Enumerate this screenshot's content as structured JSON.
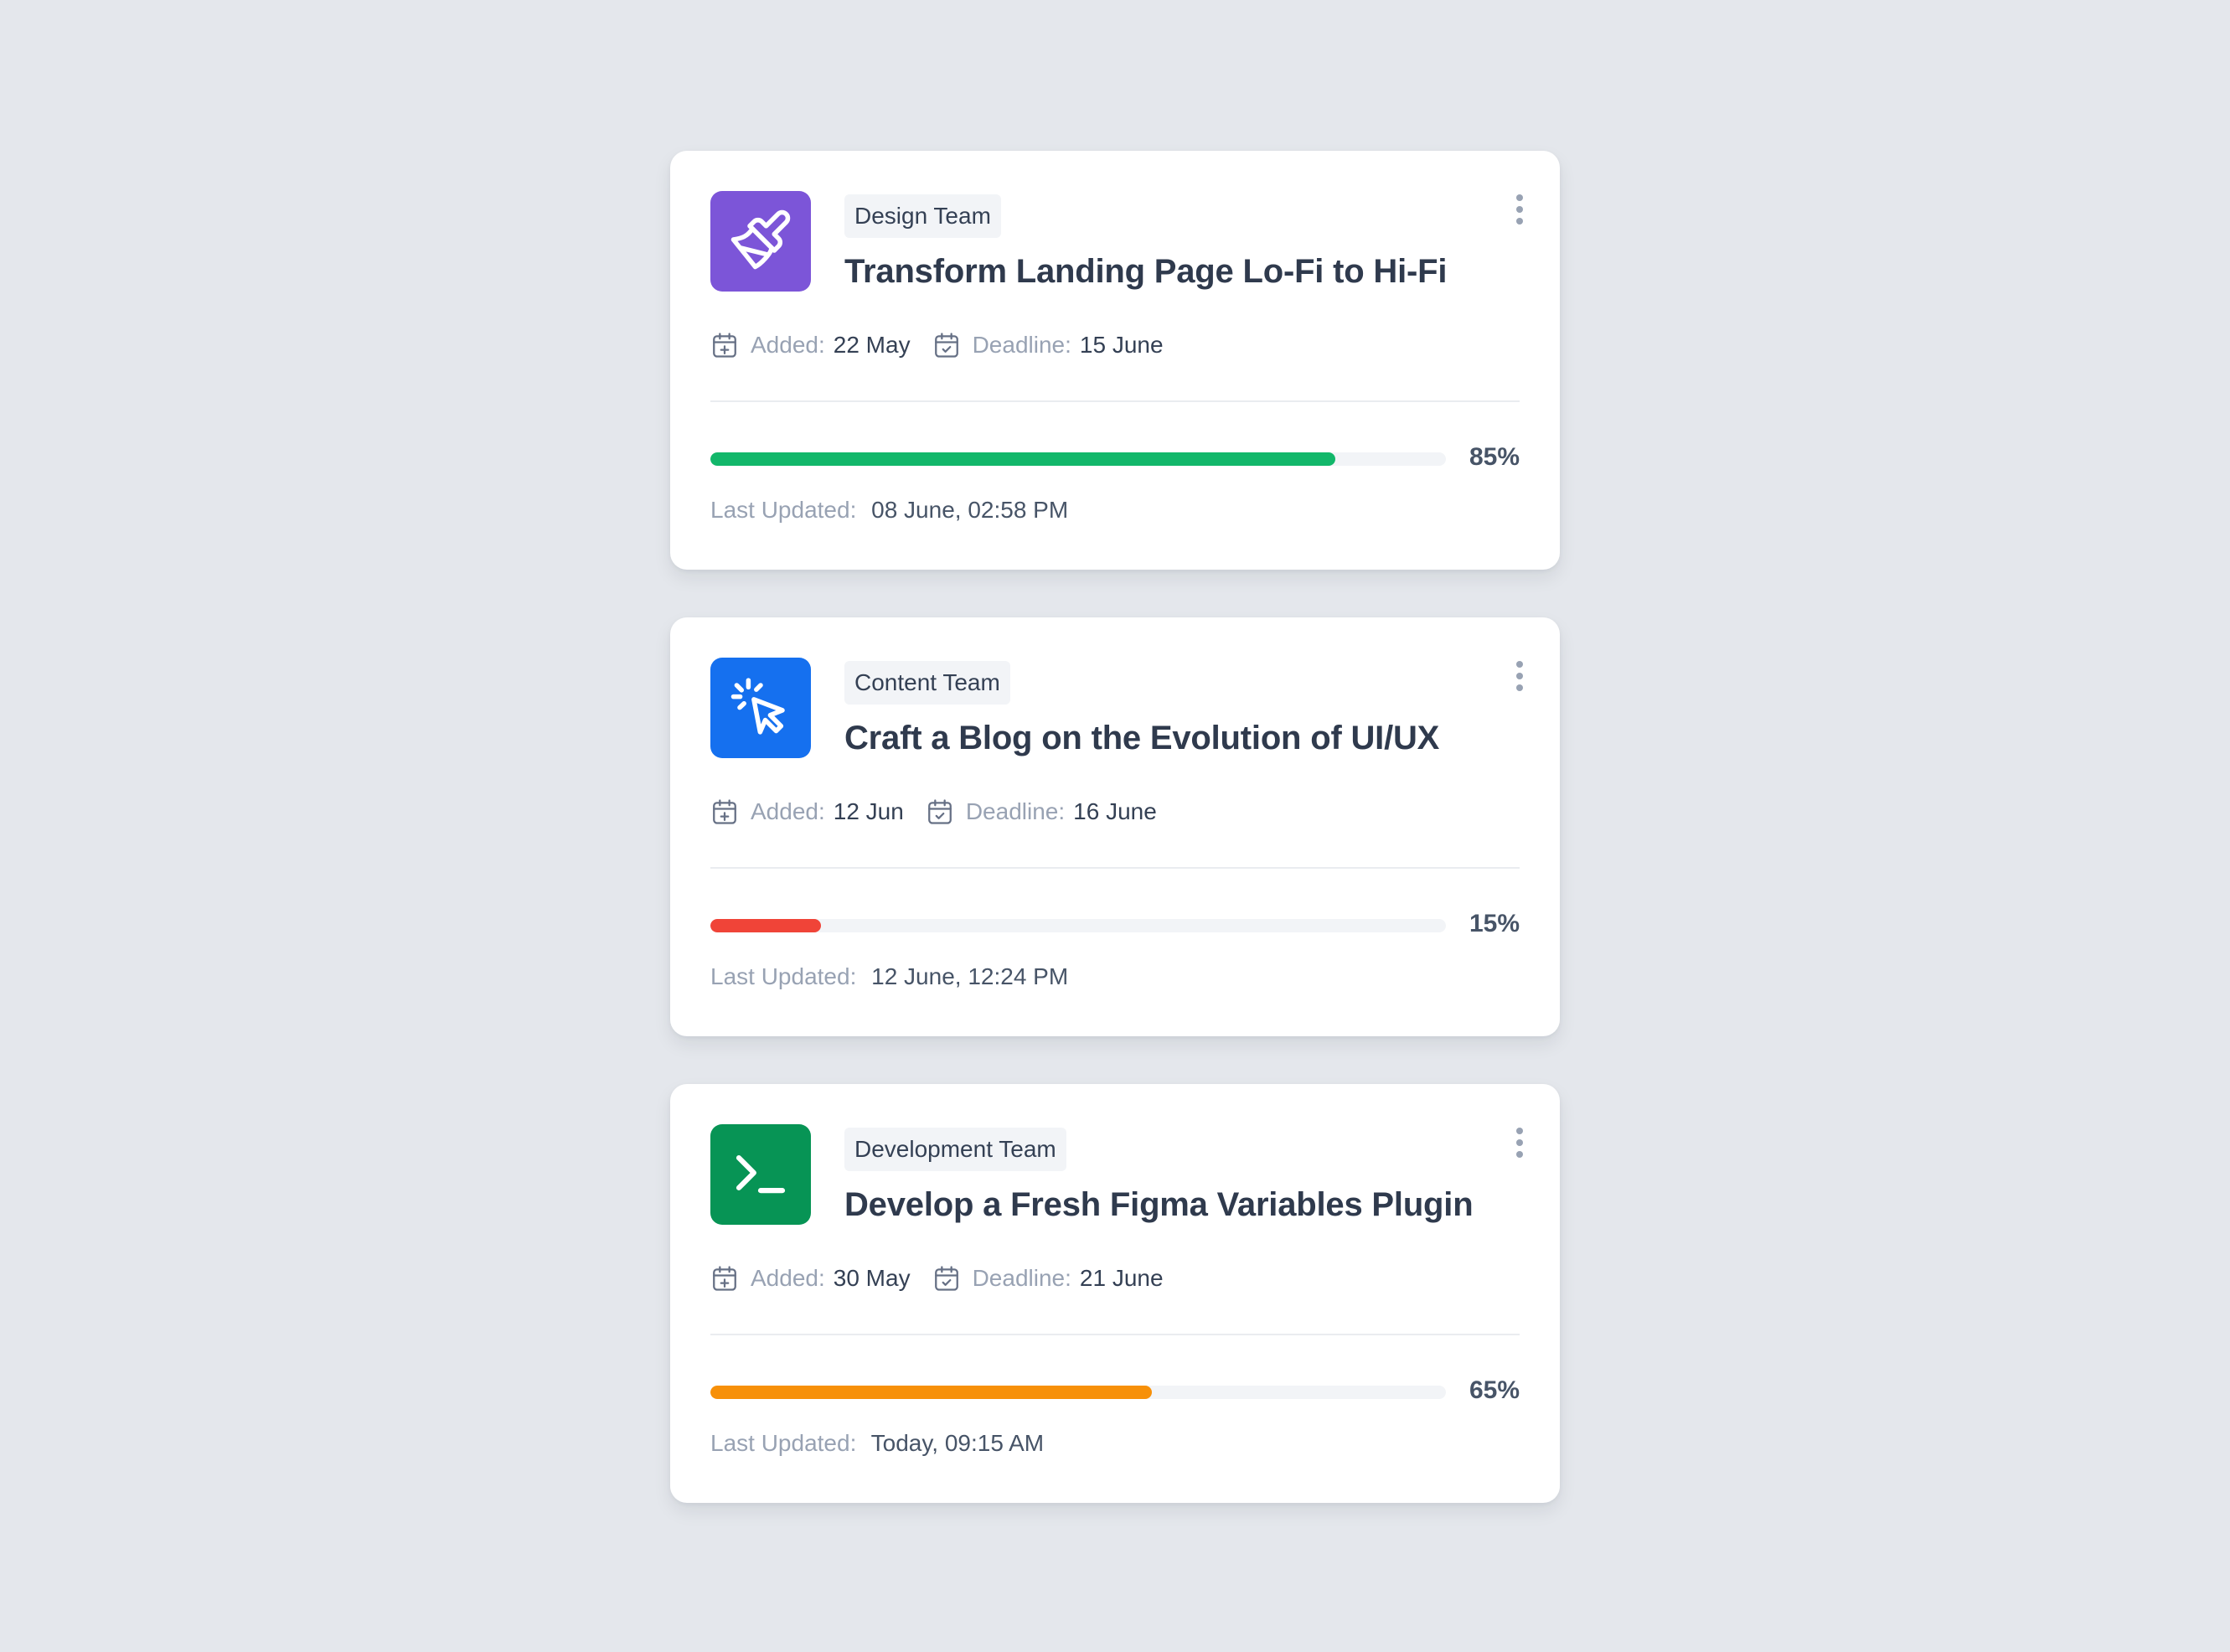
{
  "labels": {
    "added": "Added:",
    "deadline": "Deadline:",
    "last_updated": "Last Updated:"
  },
  "cards": [
    {
      "team": "Design Team",
      "title": "Transform Landing Page Lo-Fi to Hi-Fi",
      "added": "22 May",
      "deadline": "15 June",
      "progress": 85,
      "progress_label": "85%",
      "last_updated": "08 June, 02:58 PM",
      "icon": "paintbrush-icon",
      "accent": "#7c55d8",
      "bar_color": "#12b76a"
    },
    {
      "team": "Content Team",
      "title": "Craft a Blog on the Evolution of UI/UX",
      "added": "12 Jun",
      "deadline": "16 June",
      "progress": 15,
      "progress_label": "15%",
      "last_updated": "12 June, 12:24 PM",
      "icon": "cursor-click-icon",
      "accent": "#1570ef",
      "bar_color": "#f04438"
    },
    {
      "team": "Development Team",
      "title": "Develop a Fresh Figma Variables Plugin",
      "added": "30 May",
      "deadline": "21 June",
      "progress": 60,
      "progress_label": "65%",
      "last_updated": "Today, 09:15 AM",
      "icon": "terminal-icon",
      "accent": "#079455",
      "bar_color": "#f79009"
    }
  ]
}
